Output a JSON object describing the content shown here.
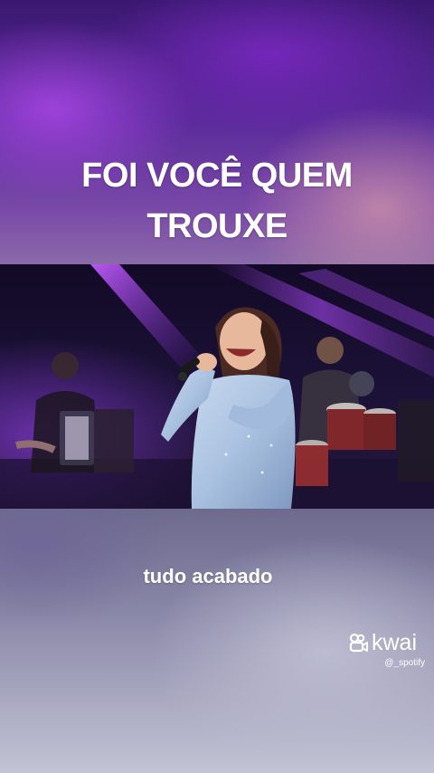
{
  "lyrics": {
    "headline_line1": "FOI VOCÊ QUEM",
    "headline_line2": "TROUXE",
    "subtitle": "tudo acabado"
  },
  "watermark": {
    "logo_icon": "kwai-logo-icon",
    "brand": "kwai",
    "handle": "@_spotify"
  },
  "colors": {
    "stage_light": "#b14cff",
    "text": "#ffffff",
    "dress": "#a9c1e0"
  }
}
